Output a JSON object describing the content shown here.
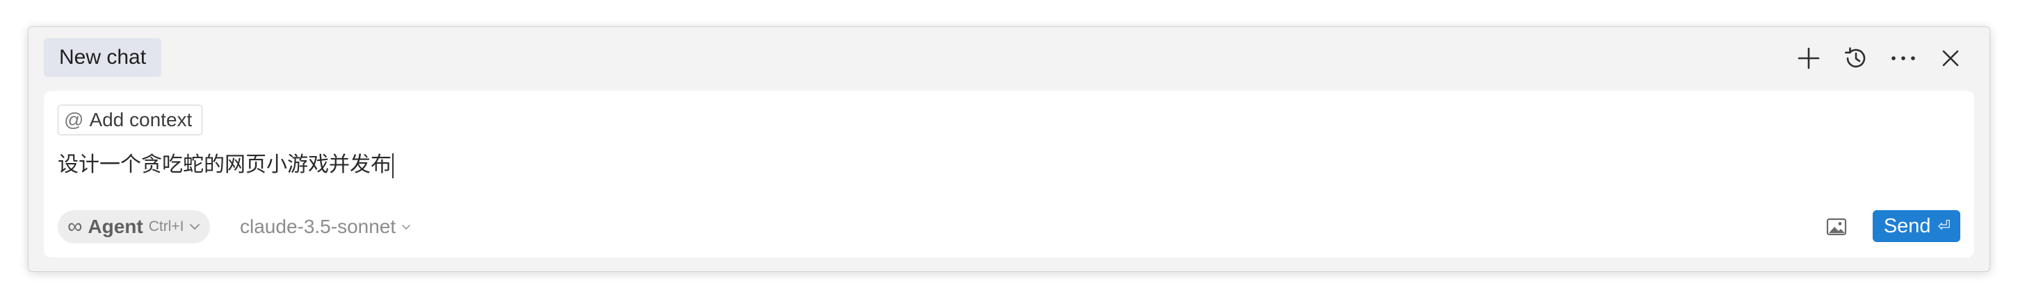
{
  "header": {
    "tab_label": "New chat",
    "actions": [
      {
        "name": "new-chat-button",
        "icon": "plus-icon"
      },
      {
        "name": "history-button",
        "icon": "history-icon"
      },
      {
        "name": "more-options-button",
        "icon": "ellipsis-icon"
      },
      {
        "name": "close-button",
        "icon": "close-icon"
      }
    ]
  },
  "composer": {
    "add_context_label": "Add context",
    "add_context_icon": "at-icon",
    "message_text": "设计一个贪吃蛇的网页小游戏并发布",
    "mode": {
      "label": "Agent",
      "shortcut": "Ctrl+I",
      "icon": "infinity-icon"
    },
    "model": {
      "label": "claude-3.5-sonnet"
    },
    "image_icon": "image-icon",
    "send_label": "Send",
    "send_icon": "enter-icon"
  },
  "colors": {
    "accent": "#1f7fd3",
    "tab_bg": "#e3e5ee",
    "panel_bg": "#f3f3f3"
  }
}
